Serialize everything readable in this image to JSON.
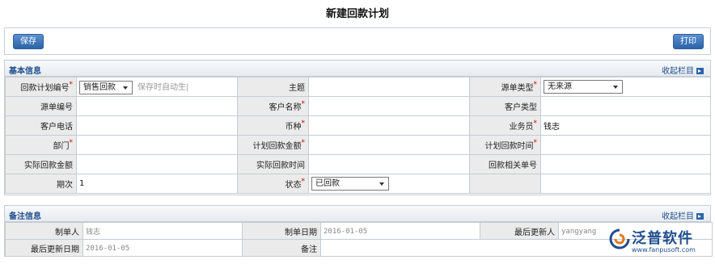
{
  "page_title": "新建回款计划",
  "toolbar": {
    "save_label": "保存",
    "print_label": "打印"
  },
  "basic": {
    "section_title": "基本信息",
    "collapse_label": "收起栏目",
    "rows": [
      [
        {
          "label": "回款计划编号",
          "required": true,
          "select": "销售回款",
          "hint": "保存时自动生|"
        },
        {
          "label": "主题",
          "required": false,
          "value": ""
        },
        {
          "label": "源单类型",
          "required": true,
          "select": "无来源"
        }
      ],
      [
        {
          "label": "源单编号",
          "required": false,
          "value": ""
        },
        {
          "label": "客户名称",
          "required": true,
          "value": ""
        },
        {
          "label": "客户类型",
          "required": false,
          "value": ""
        }
      ],
      [
        {
          "label": "客户电话",
          "required": false,
          "value": ""
        },
        {
          "label": "币种",
          "required": true,
          "value": ""
        },
        {
          "label": "业务员",
          "required": true,
          "value": "钱志"
        }
      ],
      [
        {
          "label": "部门",
          "required": true,
          "value": ""
        },
        {
          "label": "计划回款金额",
          "required": true,
          "value": ""
        },
        {
          "label": "计划回款时间",
          "required": true,
          "value": ""
        }
      ],
      [
        {
          "label": "实际回款金额",
          "required": false,
          "value": ""
        },
        {
          "label": "实际回款时间",
          "required": false,
          "value": ""
        },
        {
          "label": "回款相关单号",
          "required": false,
          "value": ""
        }
      ],
      [
        {
          "label": "期次",
          "required": false,
          "value": "1"
        },
        {
          "label": "状态",
          "required": true,
          "select": "已回款"
        },
        {
          "label": "",
          "required": false,
          "value": ""
        }
      ]
    ]
  },
  "notes": {
    "section_title": "备注信息",
    "collapse_label": "收起栏目",
    "creator_label": "制单人",
    "creator_value": "钱志",
    "create_date_label": "制单日期",
    "create_date_value": "2016-01-05",
    "last_updater_label": "最后更新人",
    "last_updater_value": "yangyang",
    "last_update_date_label": "最后更新日期",
    "last_update_date_value": "2016-01-05",
    "remark_label": "备注",
    "remark_value": ""
  },
  "logo": {
    "text": "泛普软件",
    "url": "www.fanpusoft.com",
    "color": "#1f4e8c"
  }
}
